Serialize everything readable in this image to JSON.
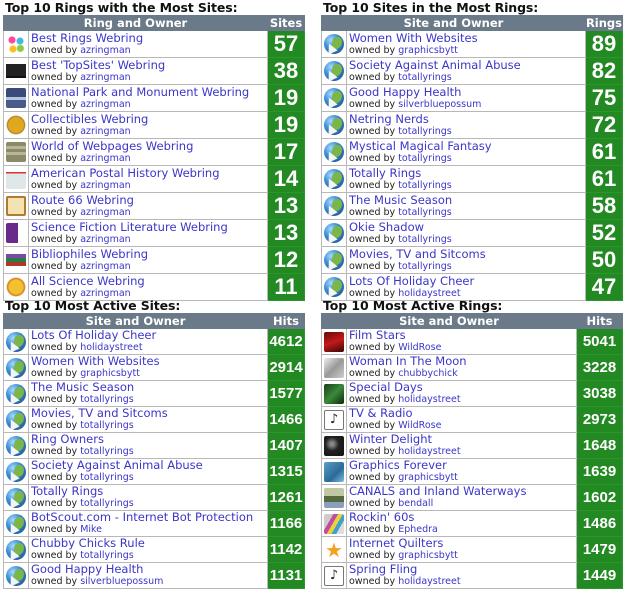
{
  "panels": {
    "rings_most_sites": {
      "title": "Top 10 Rings with the Most Sites:",
      "col_name": "Ring and Owner",
      "col_value": "Sites",
      "owned_by": "owned by",
      "rows": [
        {
          "name": "Best Rings Webring",
          "owner": "azringman",
          "value": "57",
          "icon": "best-rings-logo"
        },
        {
          "name": "Best 'TopSites' Webring",
          "owner": "azringman",
          "value": "38",
          "icon": "top-hat-logo"
        },
        {
          "name": "National Park and Monument Webring",
          "owner": "azringman",
          "value": "19",
          "icon": "landscape-logo"
        },
        {
          "name": "Collectibles Webring",
          "owner": "azringman",
          "value": "19",
          "icon": "gold-coin-logo"
        },
        {
          "name": "World of Webpages Webring",
          "owner": "azringman",
          "value": "17",
          "icon": "webpage-logo"
        },
        {
          "name": "American Postal History Webring",
          "owner": "azringman",
          "value": "14",
          "icon": "envelope-logo"
        },
        {
          "name": "Route 66 Webring",
          "owner": "azringman",
          "value": "13",
          "icon": "route-66-sign-logo"
        },
        {
          "name": "Science Fiction Literature Webring",
          "owner": "azringman",
          "value": "13",
          "icon": "sci-fi-book-logo"
        },
        {
          "name": "Bibliophiles Webring",
          "owner": "azringman",
          "value": "12",
          "icon": "books-logo"
        },
        {
          "name": "All Science Webring",
          "owner": "azringman",
          "value": "11",
          "icon": "science-logo"
        }
      ]
    },
    "sites_most_rings": {
      "title": "Top 10 Sites in the Most Rings:",
      "col_name": "Site and Owner",
      "col_value": "Rings",
      "owned_by": "owned by",
      "rows": [
        {
          "name": "Women With Websites",
          "owner": "graphicsbytt",
          "value": "89",
          "icon": "globe"
        },
        {
          "name": "Society Against Animal Abuse",
          "owner": "totallyrings",
          "value": "82",
          "icon": "globe"
        },
        {
          "name": "Good Happy Health",
          "owner": "silverbluepossum",
          "value": "75",
          "icon": "globe"
        },
        {
          "name": "Netring Nerds",
          "owner": "totallyrings",
          "value": "72",
          "icon": "globe"
        },
        {
          "name": "Mystical Magical Fantasy",
          "owner": "totallyrings",
          "value": "61",
          "icon": "globe"
        },
        {
          "name": "Totally Rings",
          "owner": "totallyrings",
          "value": "61",
          "icon": "globe"
        },
        {
          "name": "The Music Season",
          "owner": "totallyrings",
          "value": "58",
          "icon": "globe"
        },
        {
          "name": "Okie Shadow",
          "owner": "totallyrings",
          "value": "52",
          "icon": "globe"
        },
        {
          "name": "Movies, TV and Sitcoms",
          "owner": "totallyrings",
          "value": "50",
          "icon": "globe"
        },
        {
          "name": "Lots Of Holiday Cheer",
          "owner": "holidaystreet",
          "value": "47",
          "icon": "globe"
        }
      ]
    },
    "most_active_sites": {
      "title": "Top 10 Most Active Sites:",
      "col_name": "Site and Owner",
      "col_value": "Hits",
      "owned_by": "owned by",
      "rows": [
        {
          "name": "Lots Of Holiday Cheer",
          "owner": "holidaystreet",
          "value": "4612",
          "icon": "globe"
        },
        {
          "name": "Women With Websites",
          "owner": "graphicsbytt",
          "value": "2914",
          "icon": "globe"
        },
        {
          "name": "The Music Season",
          "owner": "totallyrings",
          "value": "1577",
          "icon": "globe"
        },
        {
          "name": "Movies, TV and Sitcoms",
          "owner": "totallyrings",
          "value": "1466",
          "icon": "globe"
        },
        {
          "name": "Ring Owners",
          "owner": "totallyrings",
          "value": "1407",
          "icon": "globe"
        },
        {
          "name": "Society Against Animal Abuse",
          "owner": "totallyrings",
          "value": "1315",
          "icon": "globe"
        },
        {
          "name": "Totally Rings",
          "owner": "totallyrings",
          "value": "1261",
          "icon": "globe"
        },
        {
          "name": "BotScout.com - Internet Bot Protection",
          "owner": "Mike",
          "value": "1166",
          "icon": "globe"
        },
        {
          "name": "Chubby Chicks Rule",
          "owner": "totallyrings",
          "value": "1142",
          "icon": "globe"
        },
        {
          "name": "Good Happy Health",
          "owner": "silverbluepossum",
          "value": "1131",
          "icon": "globe"
        }
      ]
    },
    "most_active_rings": {
      "title": "Top 10 Most Active Rings:",
      "col_name": "Site and Owner",
      "col_value": "Hits",
      "owned_by": "owned by",
      "rows": [
        {
          "name": "Film Stars",
          "owner": "WildRose",
          "value": "5041",
          "icon": "film-red-thumb"
        },
        {
          "name": "Woman In The Moon",
          "owner": "chubbychick",
          "value": "3228",
          "icon": "moon-grey-thumb"
        },
        {
          "name": "Special Days",
          "owner": "holidaystreet",
          "value": "3038",
          "icon": "green-leaf-thumb"
        },
        {
          "name": "TV & Radio",
          "owner": "WildRose",
          "value": "2973",
          "icon": "music-note"
        },
        {
          "name": "Winter Delight",
          "owner": "holidaystreet",
          "value": "1648",
          "icon": "winter-dark-thumb"
        },
        {
          "name": "Graphics Forever",
          "owner": "graphicsbytt",
          "value": "1639",
          "icon": "blue-graphics-thumb"
        },
        {
          "name": "CANALS and Inland Waterways",
          "owner": "bendall",
          "value": "1602",
          "icon": "canal-thumb"
        },
        {
          "name": "Rockin' 60s",
          "owner": "Ephedra",
          "value": "1486",
          "icon": "rainbow-thumb"
        },
        {
          "name": "Internet Quilters",
          "owner": "graphicsbytt",
          "value": "1479",
          "icon": "star"
        },
        {
          "name": "Spring Fling",
          "owner": "holidaystreet",
          "value": "1449",
          "icon": "music-note"
        }
      ]
    }
  },
  "colors": {
    "header_bg": "#6b7a88",
    "count_bg": "#238a23",
    "link": "#3a36c8"
  }
}
